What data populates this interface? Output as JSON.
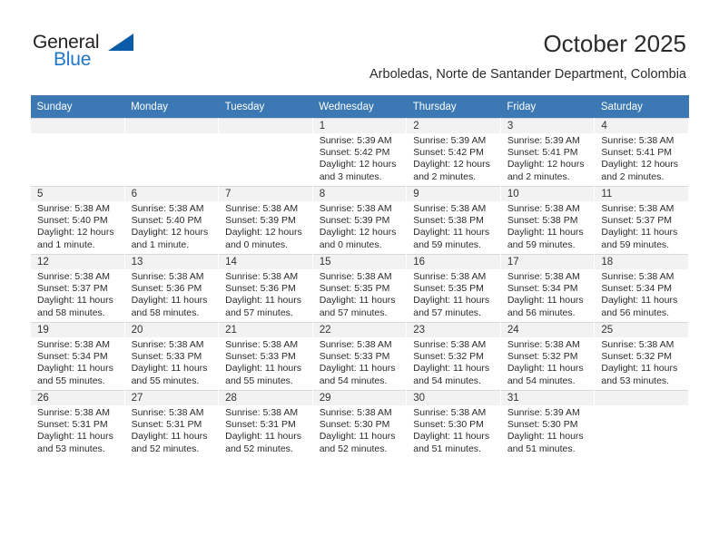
{
  "brand": {
    "name_dark": "General",
    "name_light": "Blue",
    "triangle_color": "#0a5ca8",
    "light_color": "#2176c7"
  },
  "header": {
    "title": "October 2025",
    "subtitle": "Arboledas, Norte de Santander Department, Colombia"
  },
  "theme": {
    "header_bg": "#3b78b4",
    "header_text": "#ffffff",
    "cell_shade": "#f2f2f2",
    "grid_line": "#d9d9d9"
  },
  "calendar": {
    "weekday_headers": [
      "Sunday",
      "Monday",
      "Tuesday",
      "Wednesday",
      "Thursday",
      "Friday",
      "Saturday"
    ],
    "weeks": [
      [
        {
          "day": "",
          "empty": true
        },
        {
          "day": "",
          "empty": true
        },
        {
          "day": "",
          "empty": true
        },
        {
          "day": "1",
          "sunrise": "Sunrise: 5:39 AM",
          "sunset": "Sunset: 5:42 PM",
          "daylight1": "Daylight: 12 hours",
          "daylight2": "and 3 minutes."
        },
        {
          "day": "2",
          "sunrise": "Sunrise: 5:39 AM",
          "sunset": "Sunset: 5:42 PM",
          "daylight1": "Daylight: 12 hours",
          "daylight2": "and 2 minutes."
        },
        {
          "day": "3",
          "sunrise": "Sunrise: 5:39 AM",
          "sunset": "Sunset: 5:41 PM",
          "daylight1": "Daylight: 12 hours",
          "daylight2": "and 2 minutes."
        },
        {
          "day": "4",
          "sunrise": "Sunrise: 5:38 AM",
          "sunset": "Sunset: 5:41 PM",
          "daylight1": "Daylight: 12 hours",
          "daylight2": "and 2 minutes."
        }
      ],
      [
        {
          "day": "5",
          "sunrise": "Sunrise: 5:38 AM",
          "sunset": "Sunset: 5:40 PM",
          "daylight1": "Daylight: 12 hours",
          "daylight2": "and 1 minute."
        },
        {
          "day": "6",
          "sunrise": "Sunrise: 5:38 AM",
          "sunset": "Sunset: 5:40 PM",
          "daylight1": "Daylight: 12 hours",
          "daylight2": "and 1 minute."
        },
        {
          "day": "7",
          "sunrise": "Sunrise: 5:38 AM",
          "sunset": "Sunset: 5:39 PM",
          "daylight1": "Daylight: 12 hours",
          "daylight2": "and 0 minutes."
        },
        {
          "day": "8",
          "sunrise": "Sunrise: 5:38 AM",
          "sunset": "Sunset: 5:39 PM",
          "daylight1": "Daylight: 12 hours",
          "daylight2": "and 0 minutes."
        },
        {
          "day": "9",
          "sunrise": "Sunrise: 5:38 AM",
          "sunset": "Sunset: 5:38 PM",
          "daylight1": "Daylight: 11 hours",
          "daylight2": "and 59 minutes."
        },
        {
          "day": "10",
          "sunrise": "Sunrise: 5:38 AM",
          "sunset": "Sunset: 5:38 PM",
          "daylight1": "Daylight: 11 hours",
          "daylight2": "and 59 minutes."
        },
        {
          "day": "11",
          "sunrise": "Sunrise: 5:38 AM",
          "sunset": "Sunset: 5:37 PM",
          "daylight1": "Daylight: 11 hours",
          "daylight2": "and 59 minutes."
        }
      ],
      [
        {
          "day": "12",
          "sunrise": "Sunrise: 5:38 AM",
          "sunset": "Sunset: 5:37 PM",
          "daylight1": "Daylight: 11 hours",
          "daylight2": "and 58 minutes."
        },
        {
          "day": "13",
          "sunrise": "Sunrise: 5:38 AM",
          "sunset": "Sunset: 5:36 PM",
          "daylight1": "Daylight: 11 hours",
          "daylight2": "and 58 minutes."
        },
        {
          "day": "14",
          "sunrise": "Sunrise: 5:38 AM",
          "sunset": "Sunset: 5:36 PM",
          "daylight1": "Daylight: 11 hours",
          "daylight2": "and 57 minutes."
        },
        {
          "day": "15",
          "sunrise": "Sunrise: 5:38 AM",
          "sunset": "Sunset: 5:35 PM",
          "daylight1": "Daylight: 11 hours",
          "daylight2": "and 57 minutes."
        },
        {
          "day": "16",
          "sunrise": "Sunrise: 5:38 AM",
          "sunset": "Sunset: 5:35 PM",
          "daylight1": "Daylight: 11 hours",
          "daylight2": "and 57 minutes."
        },
        {
          "day": "17",
          "sunrise": "Sunrise: 5:38 AM",
          "sunset": "Sunset: 5:34 PM",
          "daylight1": "Daylight: 11 hours",
          "daylight2": "and 56 minutes."
        },
        {
          "day": "18",
          "sunrise": "Sunrise: 5:38 AM",
          "sunset": "Sunset: 5:34 PM",
          "daylight1": "Daylight: 11 hours",
          "daylight2": "and 56 minutes."
        }
      ],
      [
        {
          "day": "19",
          "sunrise": "Sunrise: 5:38 AM",
          "sunset": "Sunset: 5:34 PM",
          "daylight1": "Daylight: 11 hours",
          "daylight2": "and 55 minutes."
        },
        {
          "day": "20",
          "sunrise": "Sunrise: 5:38 AM",
          "sunset": "Sunset: 5:33 PM",
          "daylight1": "Daylight: 11 hours",
          "daylight2": "and 55 minutes."
        },
        {
          "day": "21",
          "sunrise": "Sunrise: 5:38 AM",
          "sunset": "Sunset: 5:33 PM",
          "daylight1": "Daylight: 11 hours",
          "daylight2": "and 55 minutes."
        },
        {
          "day": "22",
          "sunrise": "Sunrise: 5:38 AM",
          "sunset": "Sunset: 5:33 PM",
          "daylight1": "Daylight: 11 hours",
          "daylight2": "and 54 minutes."
        },
        {
          "day": "23",
          "sunrise": "Sunrise: 5:38 AM",
          "sunset": "Sunset: 5:32 PM",
          "daylight1": "Daylight: 11 hours",
          "daylight2": "and 54 minutes."
        },
        {
          "day": "24",
          "sunrise": "Sunrise: 5:38 AM",
          "sunset": "Sunset: 5:32 PM",
          "daylight1": "Daylight: 11 hours",
          "daylight2": "and 54 minutes."
        },
        {
          "day": "25",
          "sunrise": "Sunrise: 5:38 AM",
          "sunset": "Sunset: 5:32 PM",
          "daylight1": "Daylight: 11 hours",
          "daylight2": "and 53 minutes."
        }
      ],
      [
        {
          "day": "26",
          "sunrise": "Sunrise: 5:38 AM",
          "sunset": "Sunset: 5:31 PM",
          "daylight1": "Daylight: 11 hours",
          "daylight2": "and 53 minutes."
        },
        {
          "day": "27",
          "sunrise": "Sunrise: 5:38 AM",
          "sunset": "Sunset: 5:31 PM",
          "daylight1": "Daylight: 11 hours",
          "daylight2": "and 52 minutes."
        },
        {
          "day": "28",
          "sunrise": "Sunrise: 5:38 AM",
          "sunset": "Sunset: 5:31 PM",
          "daylight1": "Daylight: 11 hours",
          "daylight2": "and 52 minutes."
        },
        {
          "day": "29",
          "sunrise": "Sunrise: 5:38 AM",
          "sunset": "Sunset: 5:30 PM",
          "daylight1": "Daylight: 11 hours",
          "daylight2": "and 52 minutes."
        },
        {
          "day": "30",
          "sunrise": "Sunrise: 5:38 AM",
          "sunset": "Sunset: 5:30 PM",
          "daylight1": "Daylight: 11 hours",
          "daylight2": "and 51 minutes."
        },
        {
          "day": "31",
          "sunrise": "Sunrise: 5:39 AM",
          "sunset": "Sunset: 5:30 PM",
          "daylight1": "Daylight: 11 hours",
          "daylight2": "and 51 minutes."
        },
        {
          "day": "",
          "empty": true
        }
      ]
    ]
  }
}
